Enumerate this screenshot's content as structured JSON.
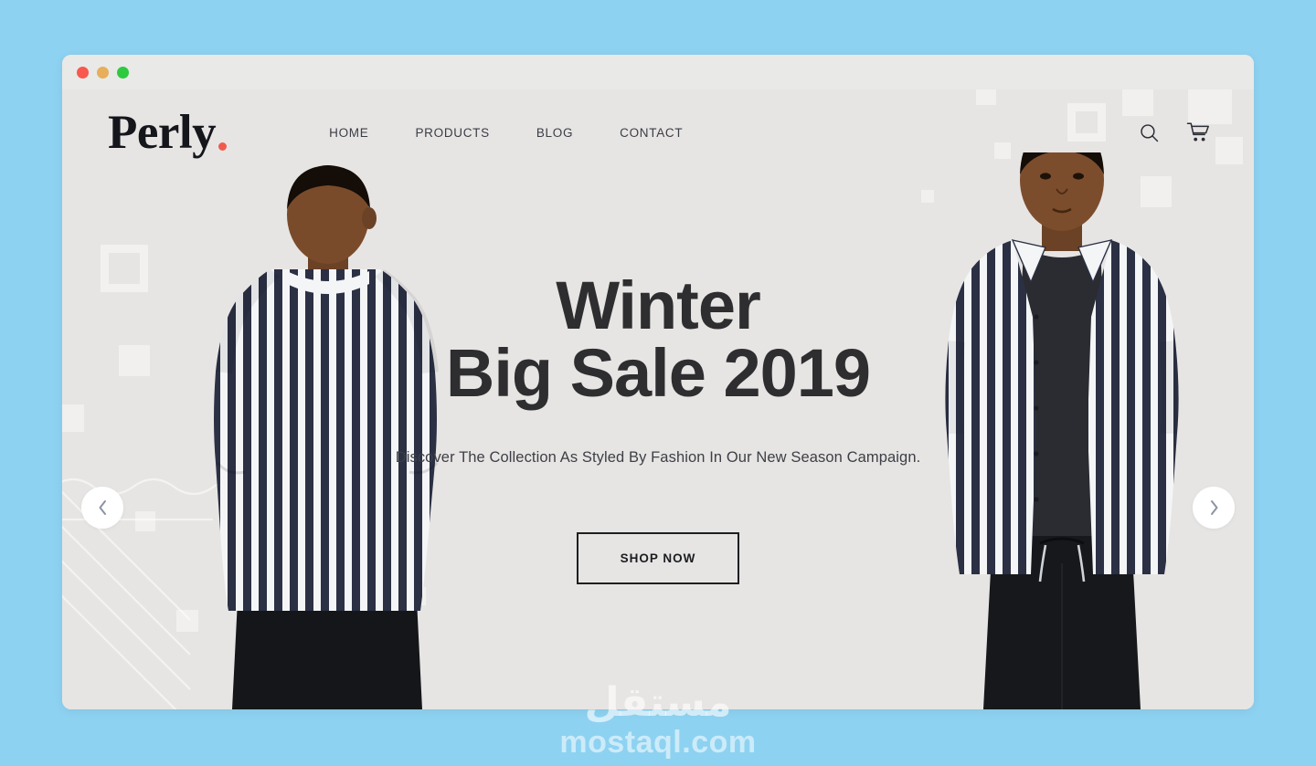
{
  "window": {
    "traffic_lights": [
      {
        "name": "close",
        "color": "#f8584e"
      },
      {
        "name": "minimize",
        "color": "#e7ae5b"
      },
      {
        "name": "maximize",
        "color": "#2dc93f"
      }
    ]
  },
  "theme": {
    "page_background": "#8ed2f1",
    "site_background": "#e7e5e3",
    "text_dark": "#2e2e30",
    "accent_dot": "#f1594f",
    "stripe_navy": "#2b3044",
    "arrow_color": "#8c93a4"
  },
  "header": {
    "logo": "Perly",
    "logo_dot": ".",
    "nav": [
      {
        "label": "HOME",
        "icon": ""
      },
      {
        "label": "PRODUCTS",
        "icon": ""
      },
      {
        "label": "BLOG",
        "icon": ""
      },
      {
        "label": "CONTACT",
        "icon": ""
      }
    ],
    "actions": [
      {
        "name": "search-icon",
        "label": "Search"
      },
      {
        "name": "cart-icon",
        "label": "Cart"
      }
    ]
  },
  "hero": {
    "title_line1": "Winter",
    "title_line2": "Big Sale 2019",
    "subtitle": "Discover The Collection As Styled By Fashion In Our New Season Campaign.",
    "cta_label": "SHOP NOW",
    "prev_arrow": "‹",
    "next_arrow": "›",
    "models": [
      {
        "name": "model-left",
        "description": "Man facing away wearing navy and white striped shirt"
      },
      {
        "name": "model-right",
        "description": "Man facing forward wearing open striped shirt over dark tee"
      }
    ]
  },
  "watermark": {
    "arabic": "مستقل",
    "latin": "mostaql.com"
  }
}
